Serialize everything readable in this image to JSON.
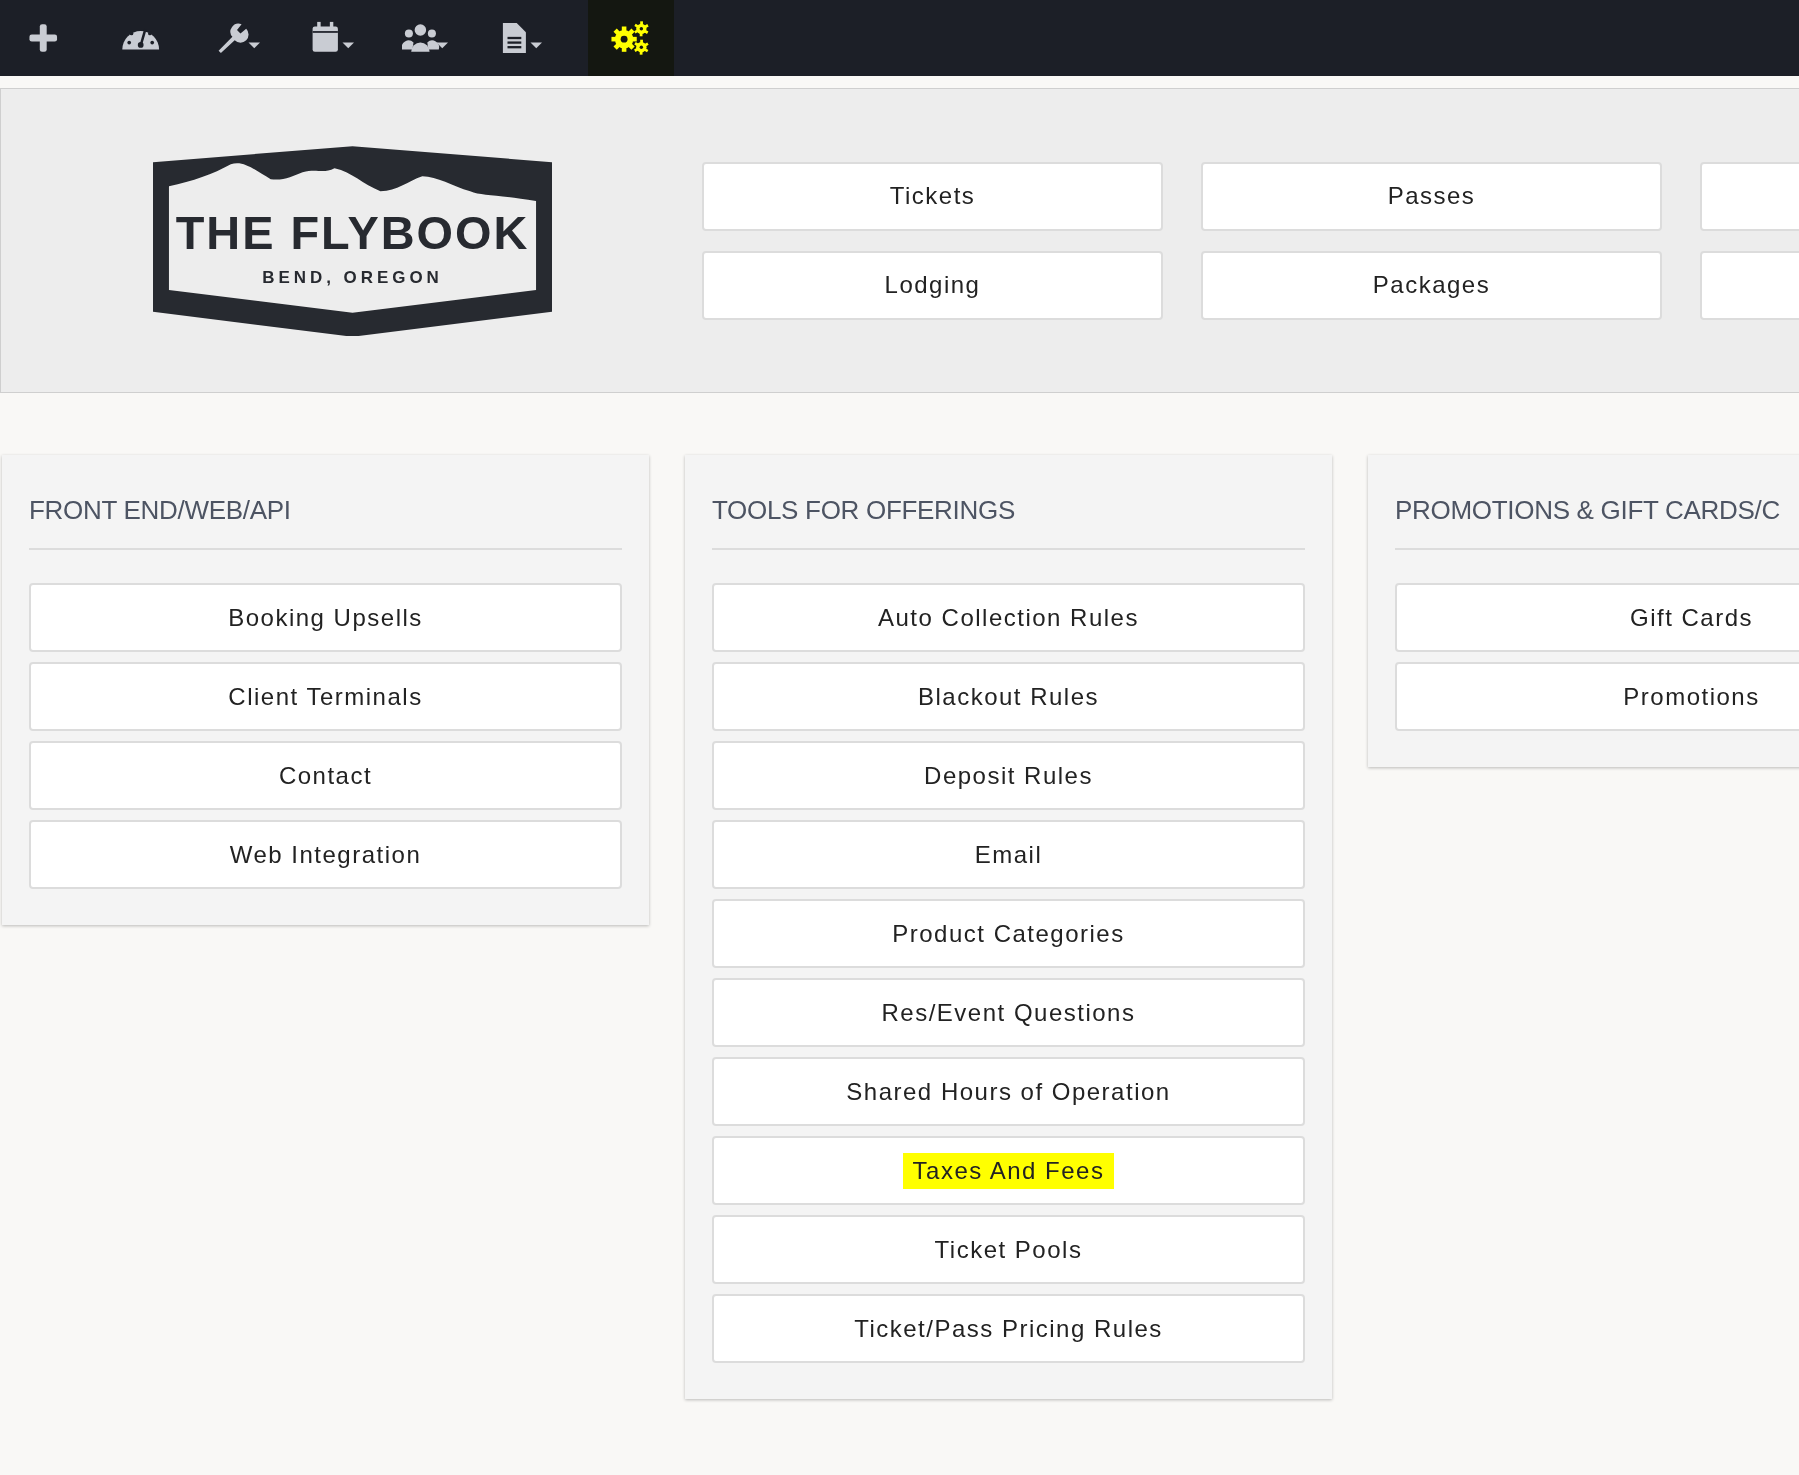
{
  "toolbar": [
    {
      "selected": false,
      "dropdown": false
    },
    {
      "selected": false,
      "dropdown": false
    },
    {
      "selected": false,
      "dropdown": true
    },
    {
      "selected": false,
      "dropdown": true
    },
    {
      "selected": false,
      "dropdown": true
    },
    {
      "selected": false,
      "dropdown": true
    },
    {
      "selected": true,
      "dropdown": false
    }
  ],
  "logo": {
    "title": "THE FLYBOOK",
    "subtitle": "BEND, OREGON"
  },
  "header_buttons": [
    [
      "Tickets",
      "Passes"
    ],
    [
      "Lodging",
      "Packages"
    ]
  ],
  "panels": [
    {
      "title": "FRONT END/WEB/API",
      "items": [
        {
          "label": "Booking Upsells",
          "highlighted": false
        },
        {
          "label": "Client Terminals",
          "highlighted": false
        },
        {
          "label": "Contact",
          "highlighted": false
        },
        {
          "label": "Web Integration",
          "highlighted": false
        }
      ]
    },
    {
      "title": "TOOLS FOR OFFERINGS",
      "items": [
        {
          "label": "Auto Collection Rules",
          "highlighted": false
        },
        {
          "label": "Blackout Rules",
          "highlighted": false
        },
        {
          "label": "Deposit Rules",
          "highlighted": false
        },
        {
          "label": "Email",
          "highlighted": false
        },
        {
          "label": "Product Categories",
          "highlighted": false
        },
        {
          "label": "Res/Event Questions",
          "highlighted": false
        },
        {
          "label": "Shared Hours of Operation",
          "highlighted": false
        },
        {
          "label": "Taxes And Fees",
          "highlighted": true
        },
        {
          "label": "Ticket Pools",
          "highlighted": false
        },
        {
          "label": "Ticket/Pass Pricing Rules",
          "highlighted": false
        }
      ]
    },
    {
      "title": "PROMOTIONS & GIFT CARDS/C",
      "items": [
        {
          "label": "Gift Cards",
          "highlighted": false
        },
        {
          "label": "Promotions",
          "highlighted": false
        }
      ]
    }
  ]
}
